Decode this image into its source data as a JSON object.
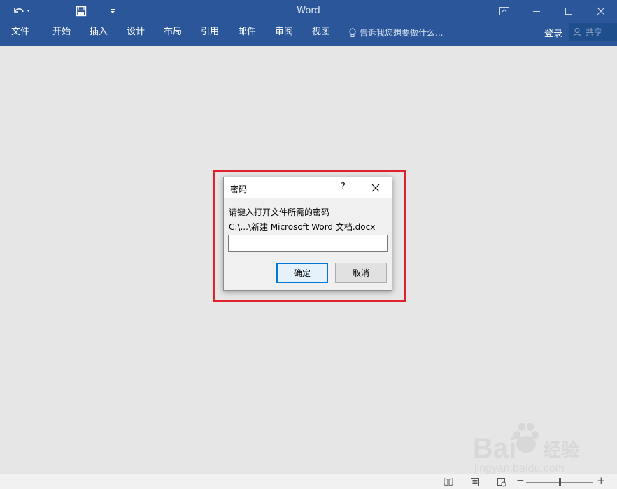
{
  "titlebar": {
    "app_title": "Word",
    "undo_icon": "undo-icon",
    "save_icon": "save-icon",
    "customize_icon": "customize-qat-icon"
  },
  "ribbon": {
    "tabs": [
      "文件",
      "开始",
      "插入",
      "设计",
      "布局",
      "引用",
      "邮件",
      "审阅",
      "视图"
    ],
    "tell_me_placeholder": "告诉我您想要做什么...",
    "login_label": "登录",
    "share_label": "共享"
  },
  "dialog": {
    "title": "密码",
    "help_label": "?",
    "prompt": "请键入打开文件所需的密码",
    "file_path": "C:\\...\\新建 Microsoft Word 文档.docx",
    "password_value": "",
    "ok_label": "确定",
    "cancel_label": "取消"
  },
  "watermark": {
    "brand_text": "Bai",
    "brand_suffix": "经验",
    "url": "jingyan.baidu.com"
  },
  "colors": {
    "ribbon_blue": "#2b579a",
    "highlight_red": "#e0202a",
    "ok_focus_blue": "#0078d7"
  }
}
